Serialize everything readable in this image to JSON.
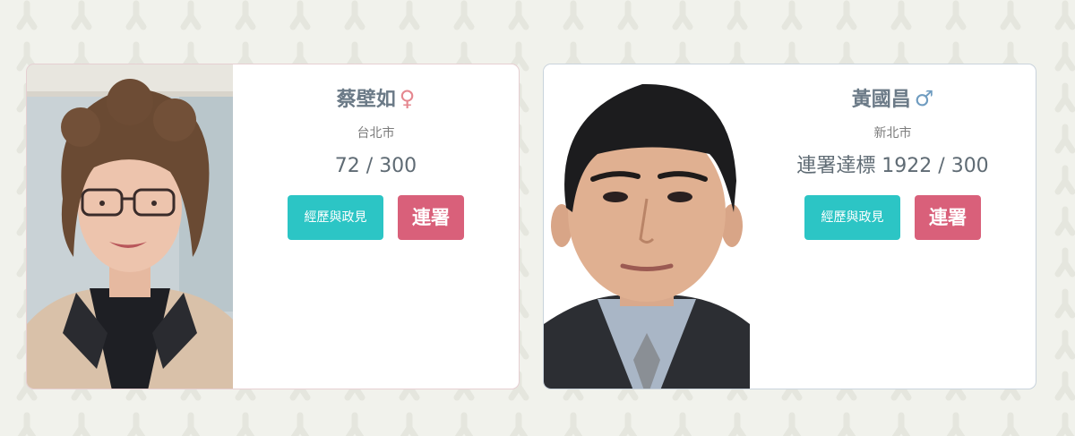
{
  "candidates": [
    {
      "name": "蔡壁如",
      "gender_symbol": "♀",
      "city": "台北市",
      "count_text": "72 / 300",
      "bio_button": "經歷與政見",
      "sign_button": "連署",
      "gender_color": "#e5878f"
    },
    {
      "name": "黃國昌",
      "gender_symbol": "♂",
      "city": "新北市",
      "count_text": "連署達標 1922 / 300",
      "bio_button": "經歷與政見",
      "sign_button": "連署",
      "gender_color": "#6f9cc0"
    }
  ],
  "colors": {
    "background": "#f1f2ec",
    "bio_button": "#2cc5c5",
    "sign_button": "#d9607a"
  }
}
